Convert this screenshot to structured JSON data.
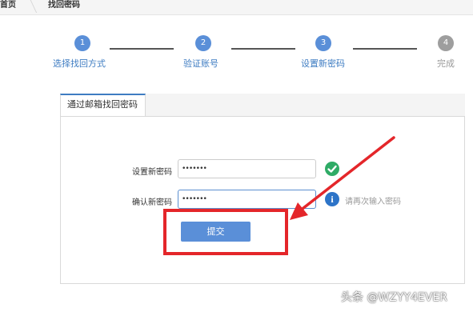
{
  "breadcrumb": {
    "home": "首页",
    "current": "找回密码"
  },
  "steps": [
    {
      "number": "1",
      "label": "选择找回方式",
      "color": "#5a8fd8"
    },
    {
      "number": "2",
      "label": "验证账号",
      "color": "#5a8fd8"
    },
    {
      "number": "3",
      "label": "设置新密码",
      "color": "#5a8fd8"
    },
    {
      "number": "4",
      "label": "完成",
      "color": "#9e9e9e"
    }
  ],
  "tab": {
    "label": "通过邮箱找回密码"
  },
  "form": {
    "new_password_label": "设置新密码",
    "new_password_value": "•••••••",
    "confirm_password_label": "确认新密码",
    "confirm_password_value": "•••••••",
    "confirm_hint": "请再次输入密码",
    "submit_label": "提交"
  },
  "colors": {
    "accent": "#5a8fd8",
    "success": "#2fab66",
    "info": "#2d74c8",
    "annotation": "#e4262a"
  },
  "watermark": "头条 @WZYY4EVER"
}
